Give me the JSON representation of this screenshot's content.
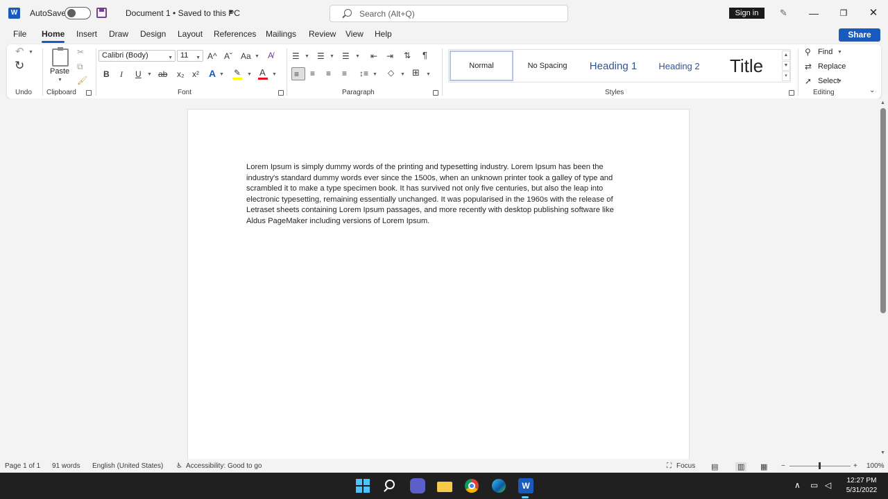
{
  "titlebar": {
    "autosave_label": "AutoSave",
    "autosave_state": "off",
    "doc_title": "Document 1 • Saved to this PC",
    "search_placeholder": "Search (Alt+Q)",
    "signin_label": "Sign in",
    "window_buttons": [
      "minimize",
      "restore",
      "close"
    ]
  },
  "tabs": [
    "File",
    "Home",
    "Insert",
    "Draw",
    "Design",
    "Layout",
    "References",
    "Mailings",
    "Review",
    "View",
    "Help"
  ],
  "active_tab": "Home",
  "share_label": "Share",
  "ribbon": {
    "groups": {
      "undo": "Undo",
      "clipboard": "Clipboard",
      "font": "Font",
      "paragraph": "Paragraph",
      "styles": "Styles",
      "editing": "Editing"
    },
    "paste_label": "Paste",
    "font_name": "Calibri (Body)",
    "font_size": "11",
    "styles": [
      "Normal",
      "No Spacing",
      "Heading 1",
      "Heading 2",
      "Title"
    ],
    "selected_style": "Normal",
    "find_label": "Find",
    "replace_label": "Replace",
    "select_label": "Select",
    "font_glyphs": {
      "grow": "A^",
      "shrink": "Aˇ",
      "change_case": "Aa",
      "bold": "B",
      "italic": "I",
      "underline": "U",
      "strikethrough": "ab",
      "subscript": "x₂",
      "superscript": "x²"
    }
  },
  "document": {
    "text": "Lorem Ipsum is simply dummy words of the printing and typesetting industry. Lorem Ipsum has been the industry's standard dummy words ever since the 1500s, when an unknown printer took a galley of type and scrambled it to make a type specimen book. It has survived not only five centuries, but also the leap into electronic typesetting, remaining essentially unchanged. It was popularised in the 1960s with the release of Letraset sheets containing Lorem Ipsum passages, and more recently with desktop publishing software like Aldus PageMaker including versions of Lorem Ipsum."
  },
  "statusbar": {
    "page": "Page 1 of 1",
    "words": "91 words",
    "language": "English (United States)",
    "accessibility": "Accessibility: Good to go",
    "focus": "Focus",
    "zoom": "100%"
  },
  "taskbar": {
    "time": "12:27 PM",
    "date": "5/31/2022"
  },
  "colors": {
    "brand": "#185abd",
    "taskbar": "#202020"
  }
}
